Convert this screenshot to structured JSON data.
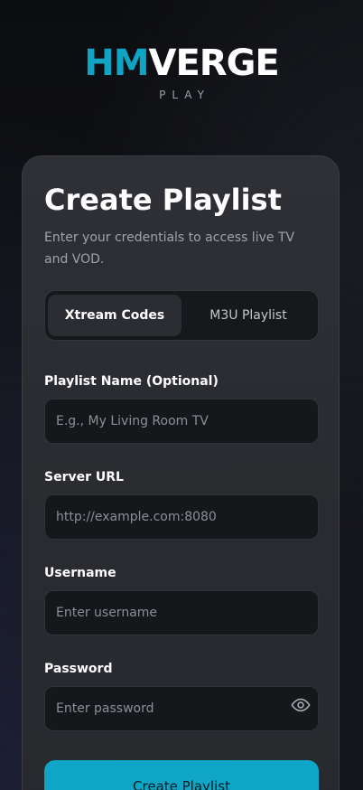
{
  "brand": {
    "name_part1": "HM",
    "name_part2": "VERGE",
    "subtitle": "PLAY",
    "accent_color": "#0fa3c4"
  },
  "card": {
    "title": "Create Playlist",
    "description": "Enter your credentials to access live TV and VOD."
  },
  "tabs": [
    {
      "label": "Xtream Codes",
      "selected": true
    },
    {
      "label": "M3U Playlist",
      "selected": false
    }
  ],
  "form": {
    "playlist_name": {
      "label": "Playlist Name (Optional)",
      "placeholder": "E.g., My Living Room TV",
      "value": ""
    },
    "server_url": {
      "label": "Server URL",
      "placeholder": "http://example.com:8080",
      "value": ""
    },
    "username": {
      "label": "Username",
      "placeholder": "Enter username",
      "value": ""
    },
    "password": {
      "label": "Password",
      "placeholder": "Enter password",
      "value": "",
      "toggle_icon": "eye-icon"
    }
  },
  "submit": {
    "label": "Create Playlist",
    "color": "#0ea5c6"
  }
}
